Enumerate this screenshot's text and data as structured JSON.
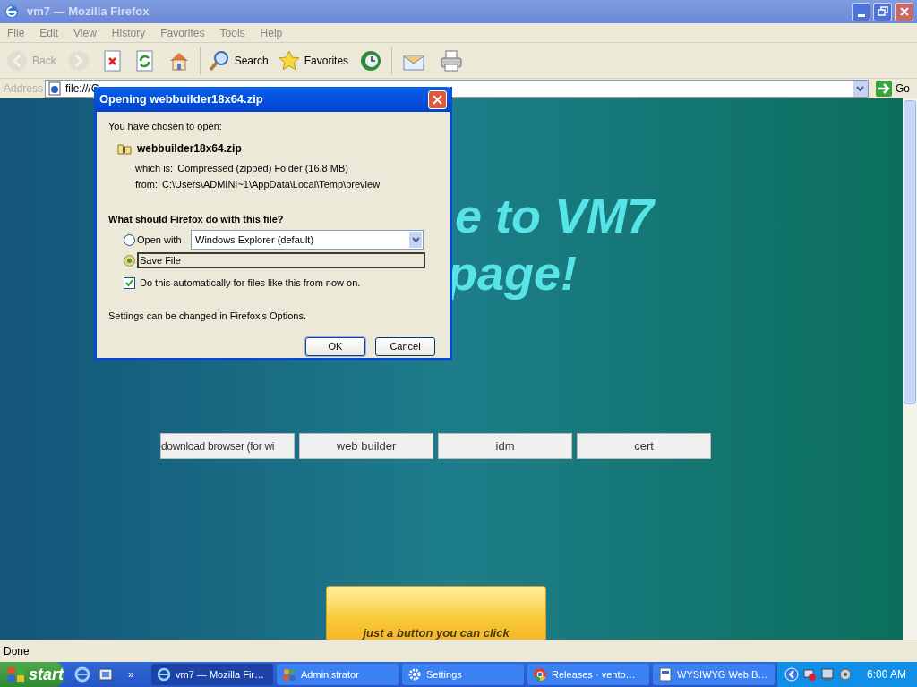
{
  "window": {
    "title": "vm7 — Mozilla Firefox"
  },
  "menu": [
    "File",
    "Edit",
    "View",
    "History",
    "Favorites",
    "Tools",
    "Help"
  ],
  "toolbar": [
    {
      "kind": "back",
      "label": "Back",
      "disabled": true
    },
    {
      "kind": "forward",
      "disabled": true
    },
    {
      "kind": "stop",
      "disabled": false
    },
    {
      "kind": "refresh",
      "disabled": false
    },
    {
      "kind": "home",
      "disabled": false
    },
    {
      "kind": "search",
      "label": "Search",
      "disabled": false
    },
    {
      "kind": "favorites",
      "label": "Favorites",
      "disabled": false
    },
    {
      "kind": "history",
      "disabled": false
    },
    {
      "kind": "mail",
      "disabled": false
    },
    {
      "kind": "print",
      "disabled": false
    }
  ],
  "address": {
    "label": "Address",
    "value": "file:///C",
    "go": "Go"
  },
  "page": {
    "heading_lines": [
      "e to VM7",
      "page!"
    ],
    "link_buttons": [
      "download browser (for wi",
      "web builder",
      "idm",
      "cert"
    ],
    "action_button": "just a button you can click"
  },
  "dialog": {
    "title": "Opening webbuilder18x64.zip",
    "intro": "You have chosen to open:",
    "file_name": "webbuilder18x64.zip",
    "which_is_label": "which is:",
    "which_is": "Compressed (zipped) Folder (16.8 MB)",
    "from_label": "from:",
    "from": "C:\\Users\\ADMINI~1\\AppData\\Local\\Temp\\preview",
    "question": "What should Firefox do with this file?",
    "options": [
      {
        "kind": "open_with",
        "label": "Open with",
        "selected": false,
        "app": "Windows Explorer (default)"
      },
      {
        "kind": "save",
        "label": "Save File",
        "selected": true
      }
    ],
    "auto": {
      "label": "Do this automatically for files like this from now on.",
      "checked": true
    },
    "note": "Settings can be changed in Firefox's Options.",
    "buttons": [
      "OK",
      "Cancel"
    ]
  },
  "status_bar": "Done",
  "taskbar": {
    "start": "start",
    "more": "»",
    "tasks": [
      {
        "kind": "browser",
        "label": "vm7 — Mozilla Fir…",
        "selected": true
      },
      {
        "kind": "users",
        "label": "Administrator",
        "selected": false
      },
      {
        "kind": "gear",
        "label": "Settings",
        "selected": false
      },
      {
        "kind": "chrome",
        "label": "Releases · vento…",
        "selected": false
      },
      {
        "kind": "document",
        "label": "WYSIWYG Web B…",
        "selected": false
      }
    ],
    "clock": "6:00 AM"
  }
}
